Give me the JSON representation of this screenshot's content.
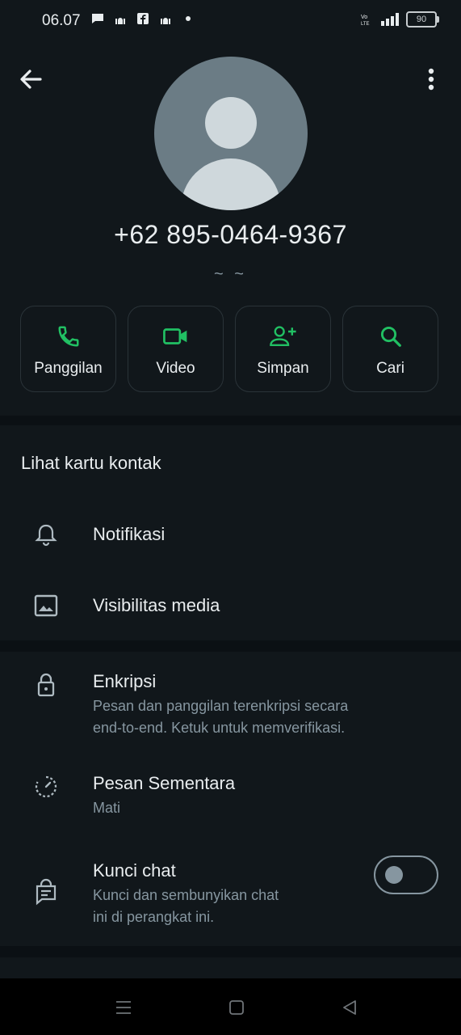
{
  "status_bar": {
    "time": "06.07",
    "battery": "90"
  },
  "profile": {
    "phone": "+62 895-0464-9367",
    "about": "~ ~"
  },
  "actions": [
    {
      "label": "Panggilan",
      "icon": "phone-icon"
    },
    {
      "label": "Video",
      "icon": "video-icon"
    },
    {
      "label": "Simpan",
      "icon": "add-person-icon"
    },
    {
      "label": "Cari",
      "icon": "search-icon"
    }
  ],
  "section1": {
    "contact_card": "Lihat kartu kontak",
    "notifications": "Notifikasi",
    "media_visibility": "Visibilitas media"
  },
  "section2": {
    "encryption_title": "Enkripsi",
    "encryption_line1": "Pesan dan panggilan terenkripsi secara",
    "encryption_line2": "end-to-end. Ketuk untuk memverifikasi.",
    "disappearing_title": "Pesan Sementara",
    "disappearing_sub": "Mati",
    "lock_title": "Kunci chat",
    "lock_line1": "Kunci dan sembunyikan chat",
    "lock_line2": "ini di perangkat ini.",
    "lock_enabled": false
  },
  "colors": {
    "accent": "#21c063",
    "background": "#0b1014",
    "surface": "#11171b",
    "secondary_text": "#8696a0"
  }
}
